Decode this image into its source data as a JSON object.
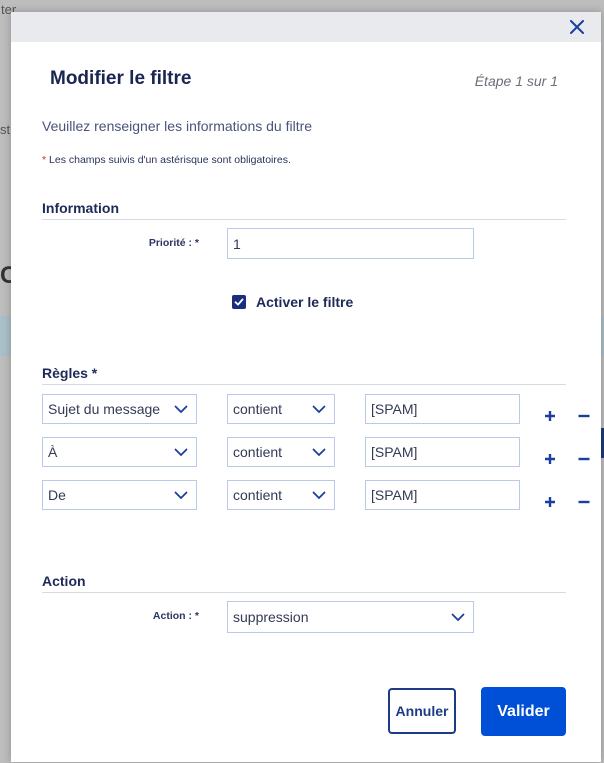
{
  "background": {
    "fragment_1": "ter",
    "fragment_2": "st",
    "fragment_3": "C"
  },
  "modal": {
    "title": "Modifier le filtre",
    "step": "Étape 1 sur 1",
    "intro": "Veuillez renseigner les informations du filtre",
    "required_star": "*",
    "required_note": " Les champs suivis d'un astérisque sont obligatoires.",
    "close_icon": "close-icon"
  },
  "information": {
    "section_title": "Information",
    "priority_label": "Priorité : *",
    "priority_value": "1",
    "activate_label": "Activer le filtre",
    "activate_checked": true
  },
  "rules": {
    "section_title": "Règles *",
    "rows": [
      {
        "field": "Sujet du message",
        "operator": "contient",
        "value": "[SPAM]"
      },
      {
        "field": "À",
        "operator": "contient",
        "value": "[SPAM]"
      },
      {
        "field": "De",
        "operator": "contient",
        "value": "[SPAM]"
      }
    ],
    "add_icon": "plus-icon",
    "remove_icon": "minus-icon"
  },
  "action": {
    "section_title": "Action",
    "action_label": "Action : *",
    "action_value": "suppression"
  },
  "buttons": {
    "cancel": "Annuler",
    "submit": "Valider"
  },
  "colors": {
    "primary": "#0050d7",
    "checkbox": "#1b2d7c",
    "header_bg": "#e8eaed",
    "input_border": "#b9c9ea",
    "required_star": "#d62828"
  }
}
